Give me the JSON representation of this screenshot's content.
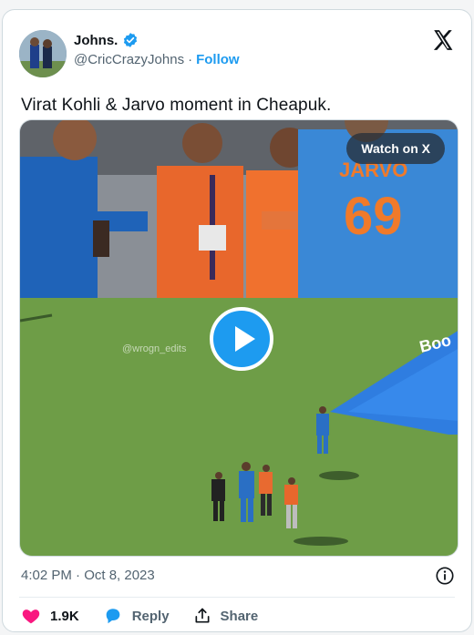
{
  "author": {
    "display_name": "Johns.",
    "handle": "@CricCrazyJohns",
    "separator": "·",
    "follow_label": "Follow"
  },
  "tweet": {
    "text": "Virat Kohli & Jarvo moment in Cheapuk.",
    "timestamp": "4:02 PM · Oct 8, 2023"
  },
  "media": {
    "watch_label": "Watch on X",
    "watermark": "@wrogn_edits",
    "jersey_name": "JARVO",
    "jersey_number": "69",
    "board_text": "Boo"
  },
  "actions": {
    "like_count": "1.9K",
    "reply_label": "Reply",
    "share_label": "Share"
  },
  "colors": {
    "accent": "#1d9bf0",
    "like": "#f91880",
    "text": "#0f1419",
    "muted": "#536471"
  }
}
